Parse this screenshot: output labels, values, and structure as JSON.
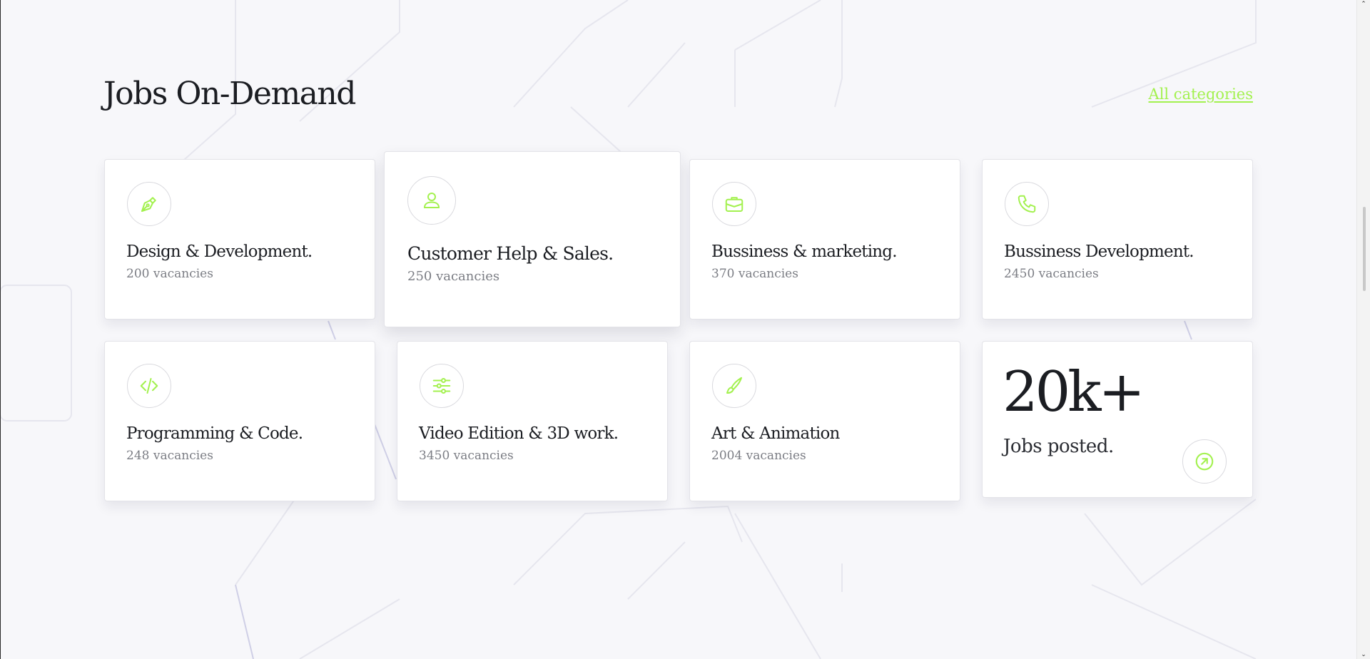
{
  "section": {
    "title": "Jobs On-Demand",
    "all_link": "All categories"
  },
  "colors": {
    "accent": "#a3f14f",
    "text": "#1b1d22",
    "muted": "#7b7d84"
  },
  "categories": [
    {
      "title": "Design & Development.",
      "vacancies": "200 vacancies",
      "icon": "pen-tool-icon"
    },
    {
      "title": "Customer Help & Sales.",
      "vacancies": "250 vacancies",
      "icon": "user-icon"
    },
    {
      "title": "Bussiness & marketing.",
      "vacancies": "370 vacancies",
      "icon": "briefcase-icon"
    },
    {
      "title": "Bussiness Development.",
      "vacancies": "2450 vacancies",
      "icon": "phone-icon"
    },
    {
      "title": "Programming & Code.",
      "vacancies": "248 vacancies",
      "icon": "code-icon"
    },
    {
      "title": "Video Edition & 3D work.",
      "vacancies": "3450 vacancies",
      "icon": "sliders-icon"
    },
    {
      "title": "Art & Animation",
      "vacancies": "2004 vacancies",
      "icon": "brush-icon"
    }
  ],
  "stats": {
    "number": "20k+",
    "label": "Jobs posted.",
    "icon": "arrow-up-right-circle-icon"
  }
}
